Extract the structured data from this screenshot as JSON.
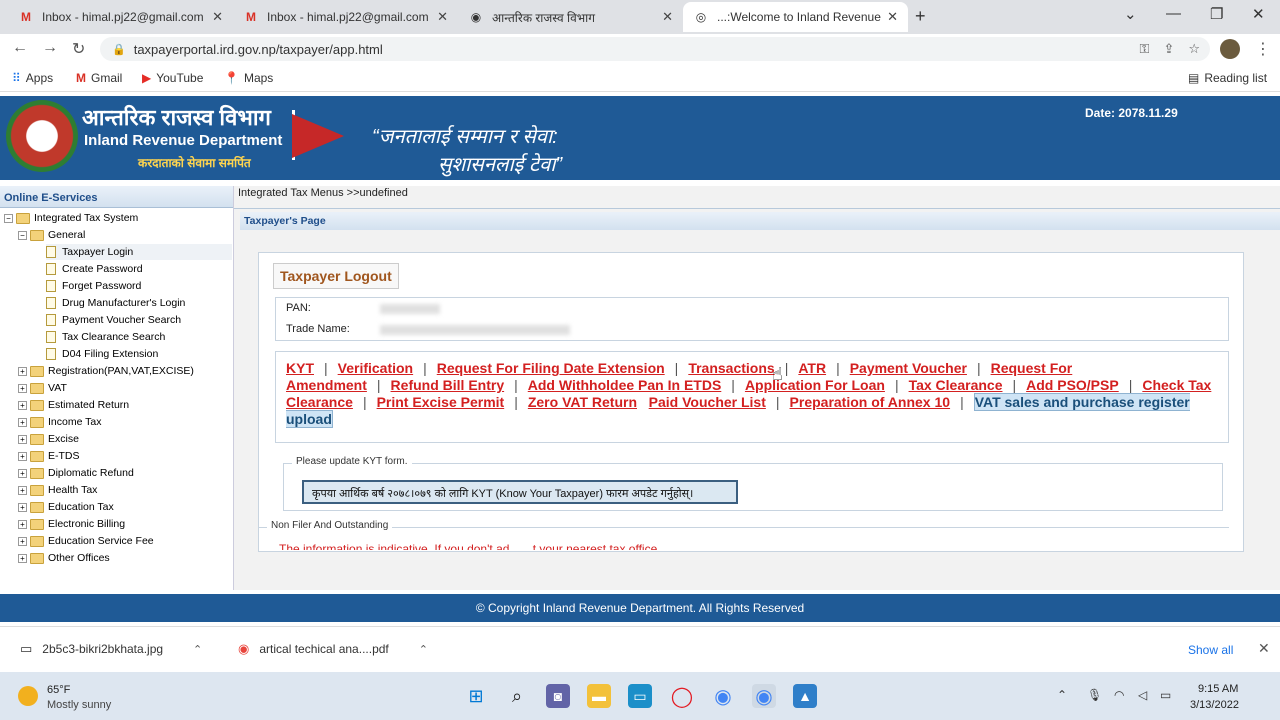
{
  "browser": {
    "tabs": [
      {
        "title": "Inbox - himal.pj22@gmail.com -",
        "icon": "gmail-icon"
      },
      {
        "title": "Inbox - himal.pj22@gmail.com -",
        "icon": "gmail-icon"
      },
      {
        "title": "आन्तरिक राजस्व विभाग",
        "icon": "globe-icon"
      },
      {
        "title": "...:Welcome to Inland Revenue De",
        "icon": "ird-icon"
      }
    ],
    "url": "taxpayerportal.ird.gov.np/taxpayer/app.html",
    "bookmarks": [
      "Apps",
      "Gmail",
      "YouTube",
      "Maps"
    ],
    "reading_list": "Reading list"
  },
  "header": {
    "title_ne": "आन्तरिक राजस्व विभाग",
    "title_en": "Inland Revenue Department",
    "slogan_small": "करदाताको सेवामा समर्पित",
    "slogan_line1": "“जनतालाई सम्मान र सेवा:",
    "slogan_line2": "सुशासनलाई टेवा”",
    "date": "Date:  2078.11.29"
  },
  "sidebar": {
    "title": "Online E-Services",
    "root": "Integrated Tax System",
    "general": "General",
    "general_items": [
      "Taxpayer Login",
      "Create Password",
      "Forget Password",
      "Drug Manufacturer's Login",
      "Payment Voucher Search",
      "Tax Clearance Search",
      "D04 Filing Extension"
    ],
    "sections": [
      "Registration(PAN,VAT,EXCISE)",
      "VAT",
      "Estimated Return",
      "Income Tax",
      "Excise",
      "E-TDS",
      "Diplomatic Refund",
      "Health Tax",
      "Education Tax",
      "Electronic Billing",
      "Education Service Fee",
      "Other Offices"
    ]
  },
  "main": {
    "breadcrumb": "Integrated Tax Menus >>undefined",
    "section_title": "Taxpayer's Page",
    "logout_label": "Taxpayer Logout",
    "pan_label": "PAN:",
    "trade_name_label": "Trade Name:",
    "links": [
      "KYT",
      "Verification",
      "Request For Filing Date Extension",
      "Transactions",
      "ATR",
      "Payment Voucher",
      "Request For Amendment",
      "Refund Bill Entry",
      "Add Withholdee Pan In ETDS",
      "Application For Loan",
      "Tax Clearance",
      "Add PSO/PSP",
      "Check Tax Clearance",
      "Print Excise Permit",
      "Zero VAT Return",
      "Paid Voucher List",
      "Preparation of Annex 10",
      "VAT sales and purchase register upload"
    ],
    "kyt_legend": "Please update KYT form.",
    "kyt_message": "कृपया आर्थिक बर्ष २०७८।०७९ को लागि KYT (Know Your Taxpayer) फारम अपडेट गर्नुहोस्।",
    "nonfiler_legend": "Non Filer And Outstanding",
    "nonfiler_text": "The information is indicative. If you don't ad... ...t your nearest tax office"
  },
  "footer": {
    "copyright": "© Copyright Inland Revenue Department. All Rights Reserved"
  },
  "downloads": {
    "items": [
      "2b5c3-bikri2bkhata.jpg",
      "artical techical ana....pdf"
    ],
    "show_all": "Show all"
  },
  "taskbar": {
    "temp": "65°F",
    "condition": "Mostly sunny",
    "time": "9:15 AM",
    "date": "3/13/2022"
  }
}
